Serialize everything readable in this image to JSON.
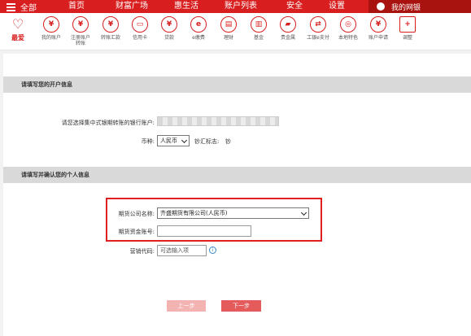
{
  "topnav": {
    "menu_label": "全部",
    "items": [
      "首页",
      "财富广场",
      "惠生活",
      "账户列表",
      "安全",
      "设置"
    ],
    "mybank_label": "我的网银"
  },
  "iconbar": {
    "items": [
      {
        "label": "最爱",
        "icon": "heart-icon",
        "glyph": "♡"
      },
      {
        "label": "我的账户",
        "icon": "yen-icon",
        "glyph": "¥"
      },
      {
        "label": "注册账户\n转账",
        "icon": "transfer-icon",
        "glyph": "¥"
      },
      {
        "label": "转账汇款",
        "icon": "remit-icon",
        "glyph": "¥"
      },
      {
        "label": "信用卡",
        "icon": "credit-card-icon",
        "glyph": "▭"
      },
      {
        "label": "贷款",
        "icon": "loan-icon",
        "glyph": "¥"
      },
      {
        "label": "e缴费",
        "icon": "epay-icon",
        "glyph": "e"
      },
      {
        "label": "理财",
        "icon": "wealth-icon",
        "glyph": "▤"
      },
      {
        "label": "基金",
        "icon": "fund-icon",
        "glyph": "▥"
      },
      {
        "label": "贵金属",
        "icon": "gold-icon",
        "glyph": "▰"
      },
      {
        "label": "工银e支付",
        "icon": "e-pay-icon",
        "glyph": "⇄"
      },
      {
        "label": "本地特色",
        "icon": "local-icon",
        "glyph": "◎"
      },
      {
        "label": "账户申请",
        "icon": "apply-icon",
        "glyph": "¥"
      },
      {
        "label": "调整",
        "icon": "adjust-icon",
        "glyph": "+"
      }
    ]
  },
  "section1": {
    "title": "请填写您的开户信息",
    "account_label": "请您选择集中式银期转账的银行账户:",
    "currency_label": "币种:",
    "currency_value": "人民币",
    "cash_flag_label": "钞汇标志:",
    "cash_flag_value": "钞"
  },
  "section2": {
    "title": "请填写并确认您的个人信息",
    "futures_company_label": "期货公司名称:",
    "futures_company_value": "齐盛期货有限公司(人民币)",
    "futures_account_label": "期货资金账号:",
    "futures_account_value": "",
    "marketing_code_label": "营销代码:",
    "marketing_code_placeholder": "可选输入项",
    "info_glyph": "i"
  },
  "buttons": {
    "prev_label": "上一步",
    "next_label": "下一步",
    "prev_color": "#f4b3b3",
    "next_color": "#e55b5b"
  }
}
